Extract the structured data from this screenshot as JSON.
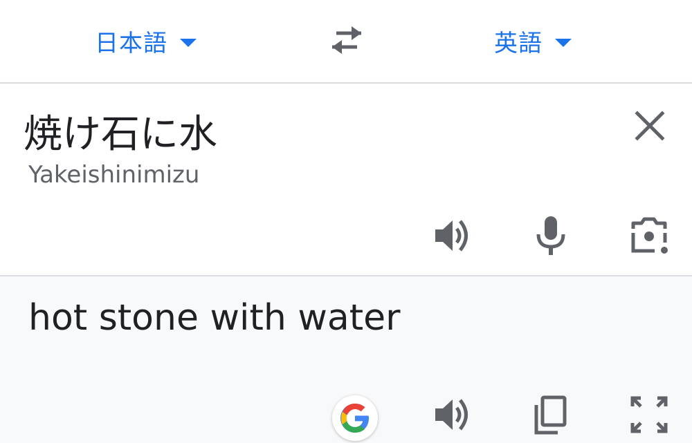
{
  "language_bar": {
    "source_language": "日本語",
    "target_language": "英語",
    "icons": {
      "swap": "swap-languages-icon",
      "dropdown": "caret-down-icon"
    }
  },
  "input": {
    "source_text": "焼け石に水",
    "romanization": "Yakeishinimizu",
    "icons": [
      "close-icon",
      "speaker-icon",
      "microphone-icon",
      "camera-icon"
    ]
  },
  "output": {
    "translated_text": "hot stone with water",
    "icons": [
      "google-logo-icon",
      "speaker-icon",
      "copy-icon",
      "fullscreen-icon"
    ]
  },
  "colors": {
    "accent": "#1a73e8",
    "icon_gray": "#5f6368",
    "text": "#202124",
    "divider": "#dadce0",
    "output_bg": "#f8f9fa"
  }
}
